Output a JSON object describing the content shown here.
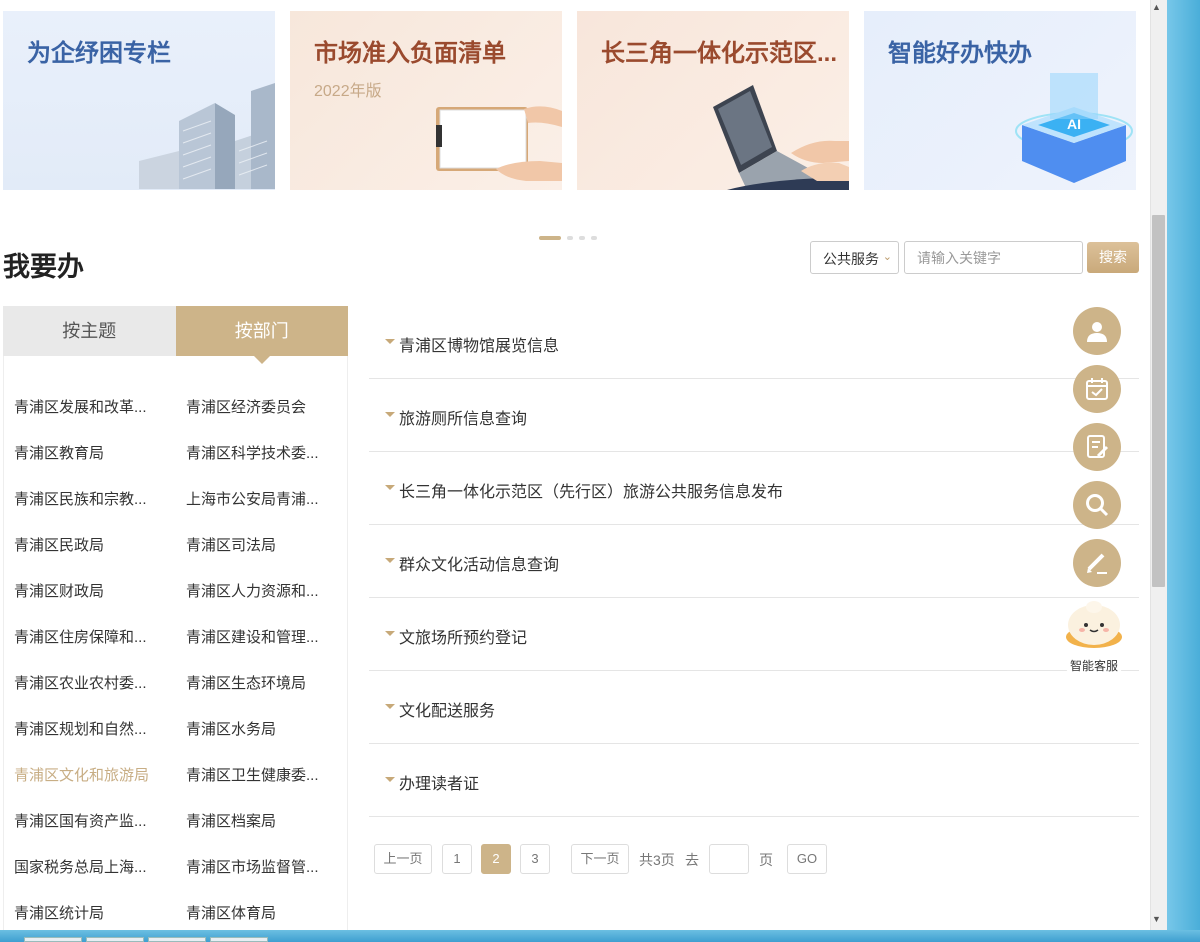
{
  "banners": [
    {
      "title": "为企纾困专栏"
    },
    {
      "title": "市场准入负面清单",
      "subtitle": "2022年版"
    },
    {
      "title": "长三角一体化示范区..."
    },
    {
      "title": "智能好办快办",
      "badge": "AI"
    }
  ],
  "section": {
    "title": "我要办"
  },
  "search": {
    "category": "公共服务",
    "placeholder": "请输入关键字",
    "button": "搜索"
  },
  "tabs": {
    "topic": "按主题",
    "department": "按部门"
  },
  "departments": [
    "青浦区发展和改革...",
    "青浦区经济委员会",
    "青浦区教育局",
    "青浦区科学技术委...",
    "青浦区民族和宗教...",
    "上海市公安局青浦...",
    "青浦区民政局",
    "青浦区司法局",
    "青浦区财政局",
    "青浦区人力资源和...",
    "青浦区住房保障和...",
    "青浦区建设和管理...",
    "青浦区农业农村委...",
    "青浦区生态环境局",
    "青浦区规划和自然...",
    "青浦区水务局",
    "青浦区文化和旅游局",
    "青浦区卫生健康委...",
    "青浦区国有资产监...",
    "青浦区档案局",
    "国家税务总局上海...",
    "青浦区市场监督管...",
    "青浦区统计局",
    "青浦区体育局"
  ],
  "services": [
    "青浦区博物馆展览信息",
    "旅游厕所信息查询",
    "长三角一体化示范区（先行区）旅游公共服务信息发布",
    "群众文化活动信息查询",
    "文旅场所预约登记",
    "文化配送服务",
    "办理读者证"
  ],
  "pagination": {
    "prev": "上一页",
    "p1": "1",
    "p2": "2",
    "p3": "3",
    "next": "下一页",
    "total": "共3页",
    "goto": "去",
    "page_unit": "页",
    "go": "GO"
  },
  "float": {
    "assistant_label": "智能客服"
  }
}
